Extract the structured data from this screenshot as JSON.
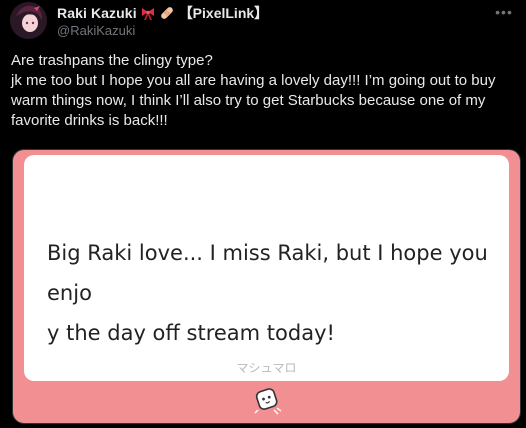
{
  "author": {
    "display_name": "Raki Kazuki",
    "emoji_1": "ribbon-emoji",
    "emoji_2": "bandage-emoji",
    "tag": "【PixelLink】",
    "handle": "@RakiKazuki",
    "avatar": "avatar-icon"
  },
  "tweet": {
    "line1": "Are trashpans the clingy type?",
    "line2": "jk me too but I hope you all are having a lovely day!!! I’m going out to buy warm things now, I think I’ll also try to get Starbucks because one of my favorite drinks is back!!!"
  },
  "card": {
    "message": "Big Raki love... I miss Raki, but I hope you enjoy the day off stream today!",
    "message_line1": "Big Raki love... I miss Raki, but I hope you enjo",
    "message_line2": "y the day off stream today!",
    "brand": "マシュマロ",
    "mascot_icon": "marshmallow-mascot-icon"
  },
  "colors": {
    "background": "#000000",
    "text": "#e7e9ea",
    "muted": "#71767b",
    "card_pink": "#f28f93"
  }
}
